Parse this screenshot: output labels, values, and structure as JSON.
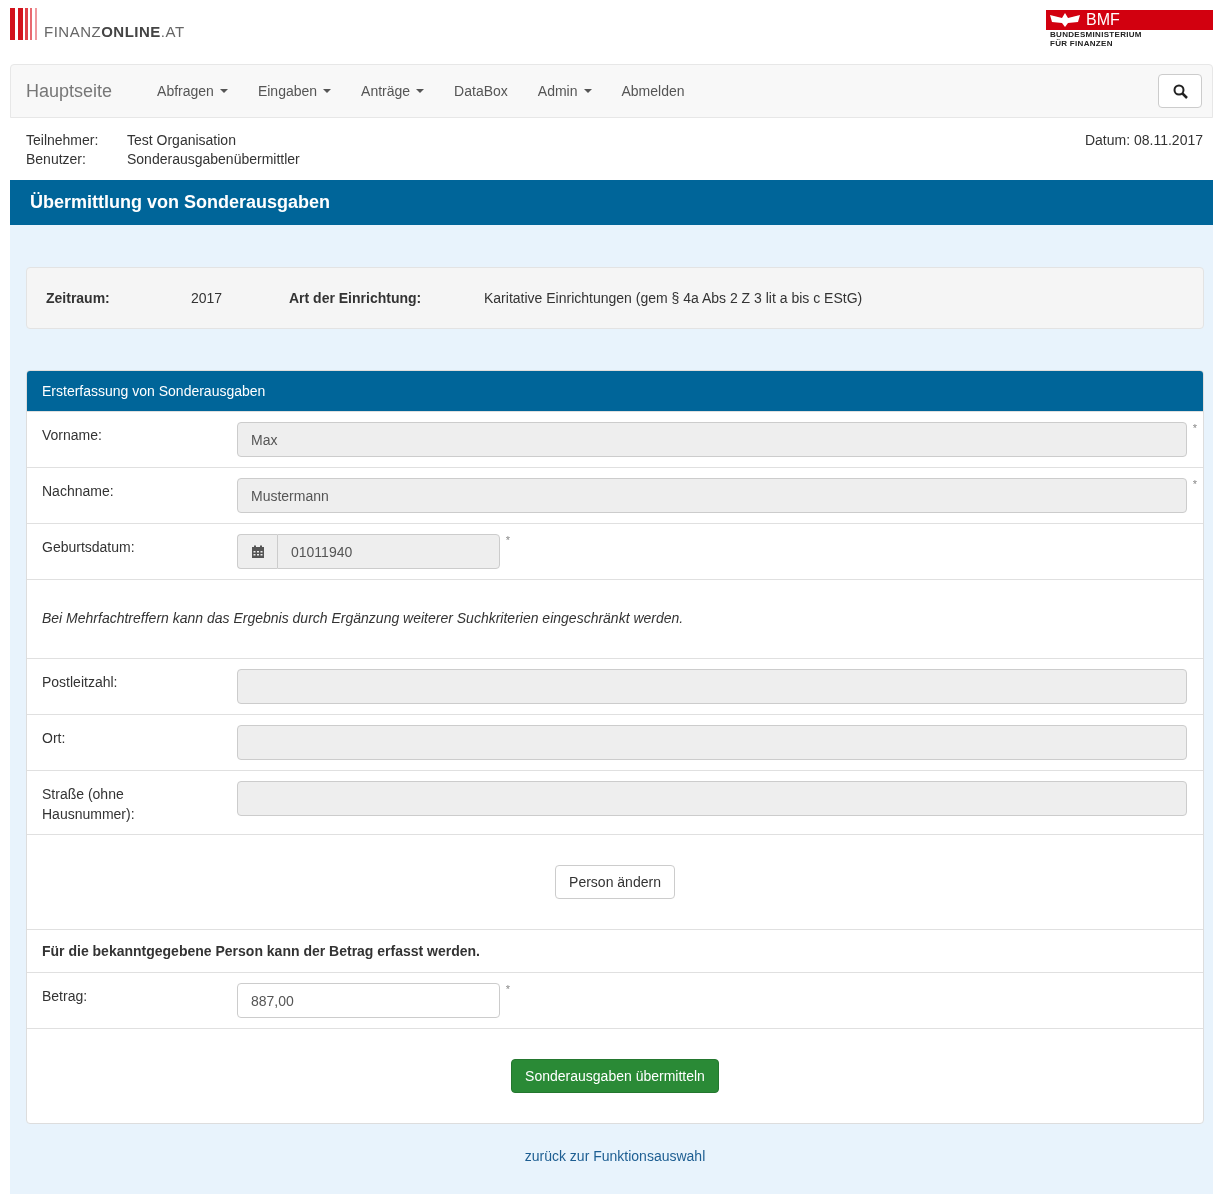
{
  "logo": {
    "light": "FINANZ",
    "bold": "ONLINE",
    "suffix": ".AT"
  },
  "ministry": {
    "abbr": "BMF",
    "line1": "BUNDESMINISTERIUM",
    "line2": "FÜR FINANZEN"
  },
  "nav": {
    "brand": "Hauptseite",
    "items": [
      {
        "label": "Abfragen",
        "dropdown": true
      },
      {
        "label": "Eingaben",
        "dropdown": true
      },
      {
        "label": "Anträge",
        "dropdown": true
      },
      {
        "label": "DataBox",
        "dropdown": false
      },
      {
        "label": "Admin",
        "dropdown": true
      },
      {
        "label": "Abmelden",
        "dropdown": false
      }
    ]
  },
  "info": {
    "rows": [
      {
        "label": "Teilnehmer:",
        "value": "Test Organisation"
      },
      {
        "label": "Benutzer:",
        "value": "Sonderausgabenübermittler"
      }
    ],
    "date": "Datum: 08.11.2017"
  },
  "page_title": "Übermittlung von Sonderausgaben",
  "summary": [
    {
      "label": "Zeitraum:",
      "value": "2017"
    },
    {
      "label": "Art der Einrichtung:",
      "value": "Karitative Einrichtungen (gem § 4a Abs 2 Z 3 lit a bis c EStG)"
    }
  ],
  "form": {
    "title": "Ersterfassung von Sonderausgaben",
    "rows": [
      {
        "kind": "text",
        "label": "Vorname:",
        "value": "Max",
        "readonly": true,
        "required_mark": "*"
      },
      {
        "kind": "text",
        "label": "Nachname:",
        "value": "Mustermann",
        "readonly": true,
        "required_mark": "*"
      },
      {
        "kind": "date",
        "label": "Geburtsdatum:",
        "value": "01011940",
        "readonly": true,
        "required_mark": "*"
      },
      {
        "kind": "note",
        "text": "Bei Mehrfachtreffern kann das Ergebnis durch Ergänzung weiterer Suchkriterien eingeschränkt werden."
      },
      {
        "kind": "text",
        "label": "Postleitzahl:",
        "readonly": true
      },
      {
        "kind": "text",
        "label": "Ort:",
        "readonly": true
      },
      {
        "kind": "text",
        "label": "Straße (ohne Hausnummer):",
        "readonly": true
      },
      {
        "kind": "button",
        "label": "Person ändern",
        "primary": false
      },
      {
        "kind": "heading",
        "text": "Für die bekanntgegebene Person kann der Betrag erfasst werden."
      },
      {
        "kind": "amount",
        "label": "Betrag:",
        "value": "887,00",
        "readonly": false,
        "required_mark": "*"
      },
      {
        "kind": "button",
        "label": "Sonderausgaben übermitteln",
        "primary": true
      }
    ]
  },
  "back_link": "zurück zur Funktionsauswahl"
}
